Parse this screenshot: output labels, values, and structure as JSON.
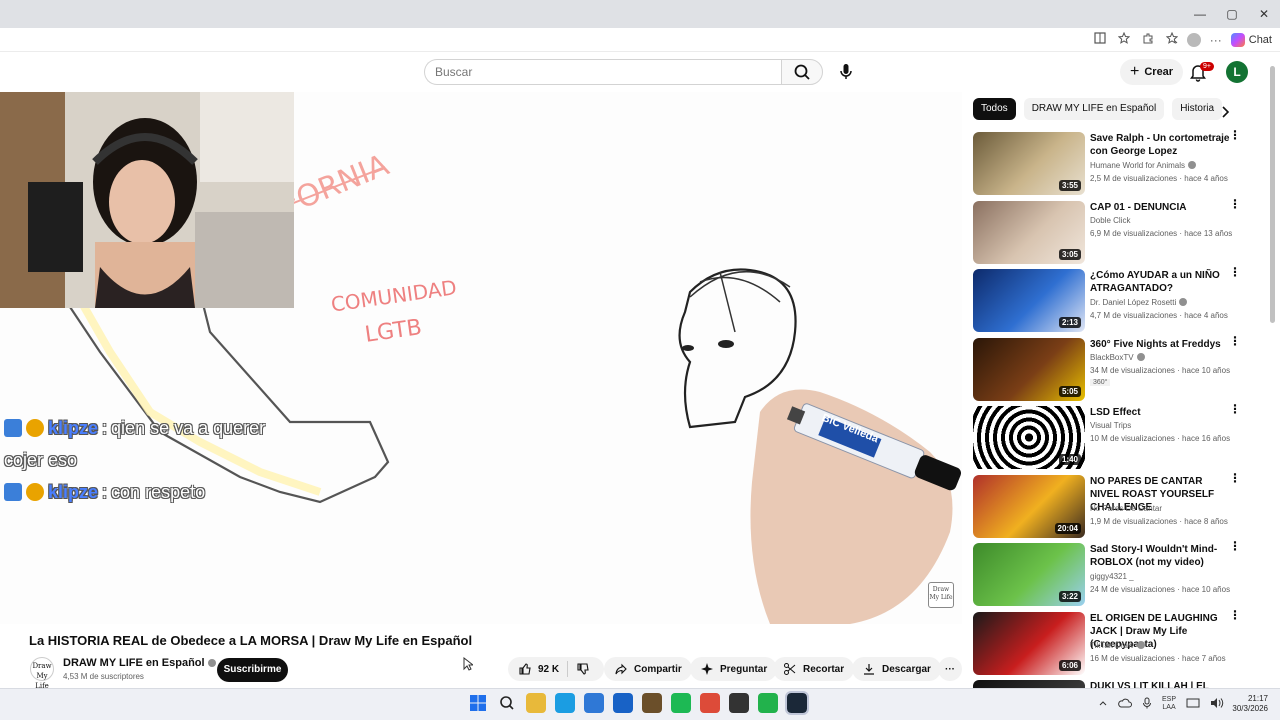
{
  "browser": {
    "window_controls": {
      "minimize": "—",
      "restore": "▢",
      "close": "✕"
    },
    "toolbar_icons": [
      "tab-icon",
      "star-icon",
      "extension-icon",
      "favorites-icon",
      "profile-icon",
      "more-icon"
    ],
    "more_label": "···",
    "chat_label": "Chat"
  },
  "header": {
    "search_placeholder": "Buscar",
    "create_label": "Crear",
    "create_plus": "+",
    "notifications_badge": "9+",
    "avatar_letter": "L"
  },
  "video": {
    "title": "La HISTORIA REAL de Obedece a LA MORSA | Draw My Life en Español",
    "channel": "DRAW MY LIFE en Español",
    "subscribers": "4,53 M de suscriptores",
    "subscribe_label": "Suscribirme",
    "likes": "92 K",
    "share_label": "Compartir",
    "ask_label": "Preguntar",
    "clip_label": "Recortar",
    "download_label": "Descargar",
    "more_label": "···",
    "watermark": "Draw My Life",
    "drawing_text": {
      "california": "CALIFORNIA",
      "community_line1": "COMUNIDAD",
      "community_line2": "LGTB",
      "marker_brand": "BiC Velleda"
    }
  },
  "stream_chat": [
    {
      "user": "klipze",
      "sep": ":",
      "message": "qien se va a querer"
    },
    {
      "user": "",
      "sep": "",
      "message": "cojer eso"
    },
    {
      "user": "klipze",
      "sep": ":",
      "message": "con respeto"
    }
  ],
  "chips": [
    "Todos",
    "DRAW MY LIFE en Español",
    "Historia"
  ],
  "recommendations": [
    {
      "title": "Save Ralph - Un cortometraje con George Lopez",
      "channel": "Humane World for Animals",
      "verified": true,
      "meta": "2,5 M de visualizaciones · hace 4 años",
      "duration": "3:55",
      "colors": [
        "#6b5b3a",
        "#c9b48a",
        "#e8e0d0"
      ]
    },
    {
      "title": "CAP 01 - DENUNCIA",
      "channel": "Doble Click",
      "verified": false,
      "meta": "6,9 M de visualizaciones · hace 13 años",
      "duration": "3:05",
      "colors": [
        "#8a7060",
        "#d8c4b0",
        "#f0e6dc"
      ]
    },
    {
      "title": "¿Cómo AYUDAR a un NIÑO ATRAGANTADO?",
      "channel": "Dr. Daniel López Rosetti",
      "verified": true,
      "meta": "4,7 M de visualizaciones · hace 4 años",
      "duration": "2:13",
      "colors": [
        "#0d2a6b",
        "#2f6fd1",
        "#e0e6f5"
      ]
    },
    {
      "title": "360° Five Nights at Freddys",
      "channel": "BlackBoxTV",
      "verified": true,
      "meta": "34 M de visualizaciones · hace 10 años",
      "tag": "360°",
      "duration": "5:05",
      "colors": [
        "#2a1608",
        "#7a3e16",
        "#e8c000"
      ]
    },
    {
      "title": "LSD Effect",
      "channel": "Visual Trips",
      "verified": false,
      "meta": "10 M de visualizaciones · hace 16 años",
      "duration": "1:40",
      "colors": [
        "#000000",
        "#ffffff",
        "#000000"
      ]
    },
    {
      "title": "NO PARES DE CANTAR  NIVEL ROAST YOURSELF CHALLENGE",
      "channel": "No Pares De Cantar",
      "verified": false,
      "meta": "1,9 M de visualizaciones · hace 8 años",
      "duration": "20:04",
      "colors": [
        "#b0302a",
        "#f0b020",
        "#3a2a20"
      ]
    },
    {
      "title": "Sad Story-I Wouldn't Mind-ROBLOX (not my video)",
      "channel": "giggy4321 _",
      "verified": false,
      "meta": "24 M de visualizaciones · hace 10 años",
      "duration": "3:22",
      "colors": [
        "#3d8a2a",
        "#6cc24a",
        "#9ad0f0"
      ]
    },
    {
      "title": "EL ORIGEN DE LAUGHING JACK | Draw My Life (Creepypasta)",
      "channel": "TikTak Draw",
      "verified": true,
      "meta": "16 M de visualizaciones · hace 7 años",
      "duration": "6:06",
      "colors": [
        "#1a1a1a",
        "#c81e1e",
        "#ffffff"
      ]
    },
    {
      "title": "DUKI VS LIT KILLAH | EL",
      "channel": "",
      "verified": false,
      "meta": "",
      "duration": "",
      "colors": [
        "#101010",
        "#303030",
        "#505050"
      ]
    }
  ],
  "taskbar": {
    "apps": [
      {
        "name": "windows-start-icon",
        "color": "#1f6feb"
      },
      {
        "name": "search-icon",
        "color": "#eef0f5"
      },
      {
        "name": "file-explorer-icon",
        "color": "#e8b93a"
      },
      {
        "name": "edge-icon",
        "color": "#1b9de2"
      },
      {
        "name": "store-icon",
        "color": "#2f78d6"
      },
      {
        "name": "outlook-icon",
        "color": "#1862c6"
      },
      {
        "name": "minecraft-icon",
        "color": "#6b4f2a"
      },
      {
        "name": "spotify-icon",
        "color": "#1db954"
      },
      {
        "name": "chrome-icon",
        "color": "#dd4b39"
      },
      {
        "name": "obs-icon",
        "color": "#333333"
      },
      {
        "name": "game-icon",
        "color": "#22b24c"
      },
      {
        "name": "steam-icon",
        "color": "#1b2838"
      }
    ],
    "lang_line1": "ESP",
    "lang_line2": "LAA",
    "time": "21:17",
    "date": "30/3/2026"
  }
}
